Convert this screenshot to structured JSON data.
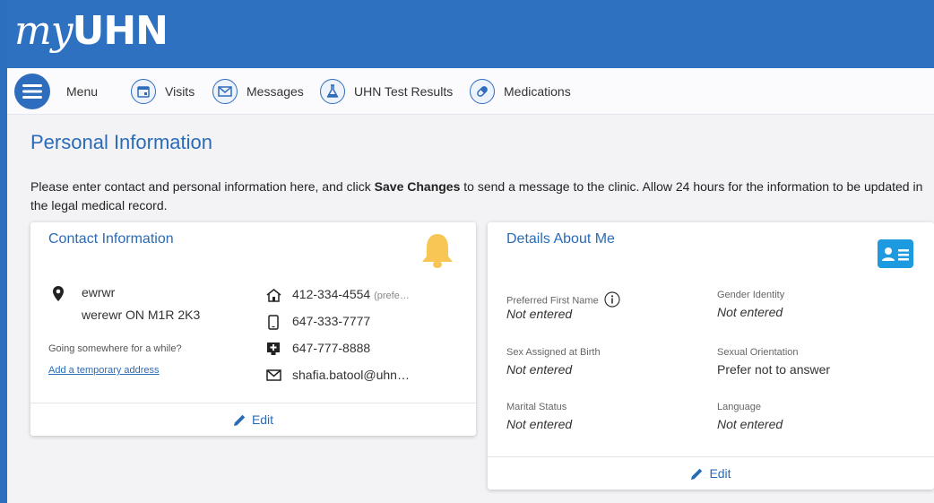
{
  "brand": {
    "logo_my": "my",
    "logo_uhn": "UHN"
  },
  "nav": {
    "menu_label": "Menu",
    "items": [
      {
        "label": "Visits",
        "icon": "calendar-icon"
      },
      {
        "label": "Messages",
        "icon": "envelope-icon"
      },
      {
        "label": "UHN Test Results",
        "icon": "flask-icon"
      },
      {
        "label": "Medications",
        "icon": "pills-icon"
      }
    ]
  },
  "page": {
    "title": "Personal Information",
    "intro_before": "Please enter contact and personal information here, and click ",
    "intro_bold": "Save Changes",
    "intro_after": " to send a message to the clinic. Allow 24 hours for the information to be updated in the legal medical record."
  },
  "contact": {
    "title": "Contact Information",
    "address_line1": "ewrwr",
    "address_line2": "werewr ON M1R 2K3",
    "temp_prompt": "Going somewhere for a while?",
    "temp_link": "Add a temporary address",
    "home_phone": "412-334-4554",
    "home_phone_suffix": "(prefe…",
    "mobile_phone": "647-333-7777",
    "work_phone": "647-777-8888",
    "email": "shafia.batool@uhn…",
    "edit_label": "Edit",
    "bell_color": "#f7c654"
  },
  "details": {
    "title": "Details About Me",
    "fields": [
      {
        "label": "Preferred First Name",
        "value": "Not entered"
      },
      {
        "label": "Gender Identity",
        "value": "Not entered"
      },
      {
        "label": "Sex Assigned at Birth",
        "value": "Not entered"
      },
      {
        "label": "Sexual Orientation",
        "value": "Prefer not to answer"
      },
      {
        "label": "Marital Status",
        "value": "Not entered"
      },
      {
        "label": "Language",
        "value": "Not entered"
      }
    ],
    "edit_label": "Edit",
    "id_card_color": "#1e9ae0"
  },
  "colors": {
    "brand_blue": "#2e71c0",
    "link_blue": "#2a6bb7"
  }
}
